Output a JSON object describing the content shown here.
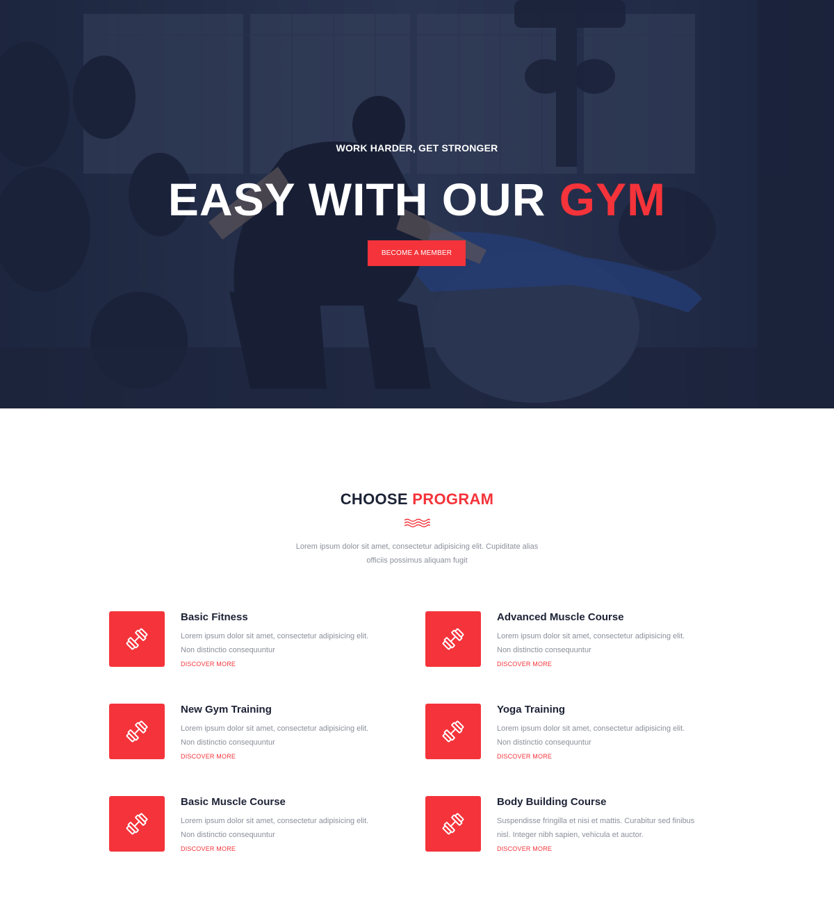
{
  "hero": {
    "tagline": "WORK HARDER, GET STRONGER",
    "title_main": "EASY WITH OUR ",
    "title_accent": "GYM",
    "cta_label": "BECOME A MEMBER"
  },
  "programs_section": {
    "title_main": "CHOOSE ",
    "title_accent": "PROGRAM",
    "description_line1": "Lorem ipsum dolor sit amet, consectetur adipisicing elit. Cupiditate alias",
    "description_line2": "officiis possimus aliquam fugit"
  },
  "programs": [
    {
      "title": "Basic Fitness",
      "desc_line1": "Lorem ipsum dolor sit amet, consectetur adipisicing elit.",
      "desc_line2": "Non distinctio consequuntur",
      "link": "DISCOVER MORE",
      "icon": "dumbbell-icon"
    },
    {
      "title": "Advanced Muscle Course",
      "desc_line1": "Lorem ipsum dolor sit amet, consectetur adipisicing elit.",
      "desc_line2": "Non distinctio consequuntur",
      "link": "DISCOVER MORE",
      "icon": "dumbbell-icon"
    },
    {
      "title": "New Gym Training",
      "desc_line1": "Lorem ipsum dolor sit amet, consectetur adipisicing elit.",
      "desc_line2": "Non distinctio consequuntur",
      "link": "DISCOVER MORE",
      "icon": "dumbbell-icon"
    },
    {
      "title": "Yoga Training",
      "desc_line1": "Lorem ipsum dolor sit amet, consectetur adipisicing elit.",
      "desc_line2": "Non distinctio consequuntur",
      "link": "DISCOVER MORE",
      "icon": "dumbbell-icon"
    },
    {
      "title": "Basic Muscle Course",
      "desc_line1": "Lorem ipsum dolor sit amet, consectetur adipisicing elit.",
      "desc_line2": "Non distinctio consequuntur",
      "link": "DISCOVER MORE",
      "icon": "dumbbell-icon"
    },
    {
      "title": "Body Building Course",
      "desc_line1": "Suspendisse fringilla et nisi et mattis. Curabitur sed finibus",
      "desc_line2": "nisl. Integer nibh sapien, vehicula et auctor.",
      "link": "DISCOVER MORE",
      "icon": "dumbbell-icon"
    }
  ],
  "colors": {
    "accent": "#f4333a",
    "dark": "#1c2235",
    "muted_text": "#8a8f9a",
    "hero_overlay": "#2a3552"
  }
}
